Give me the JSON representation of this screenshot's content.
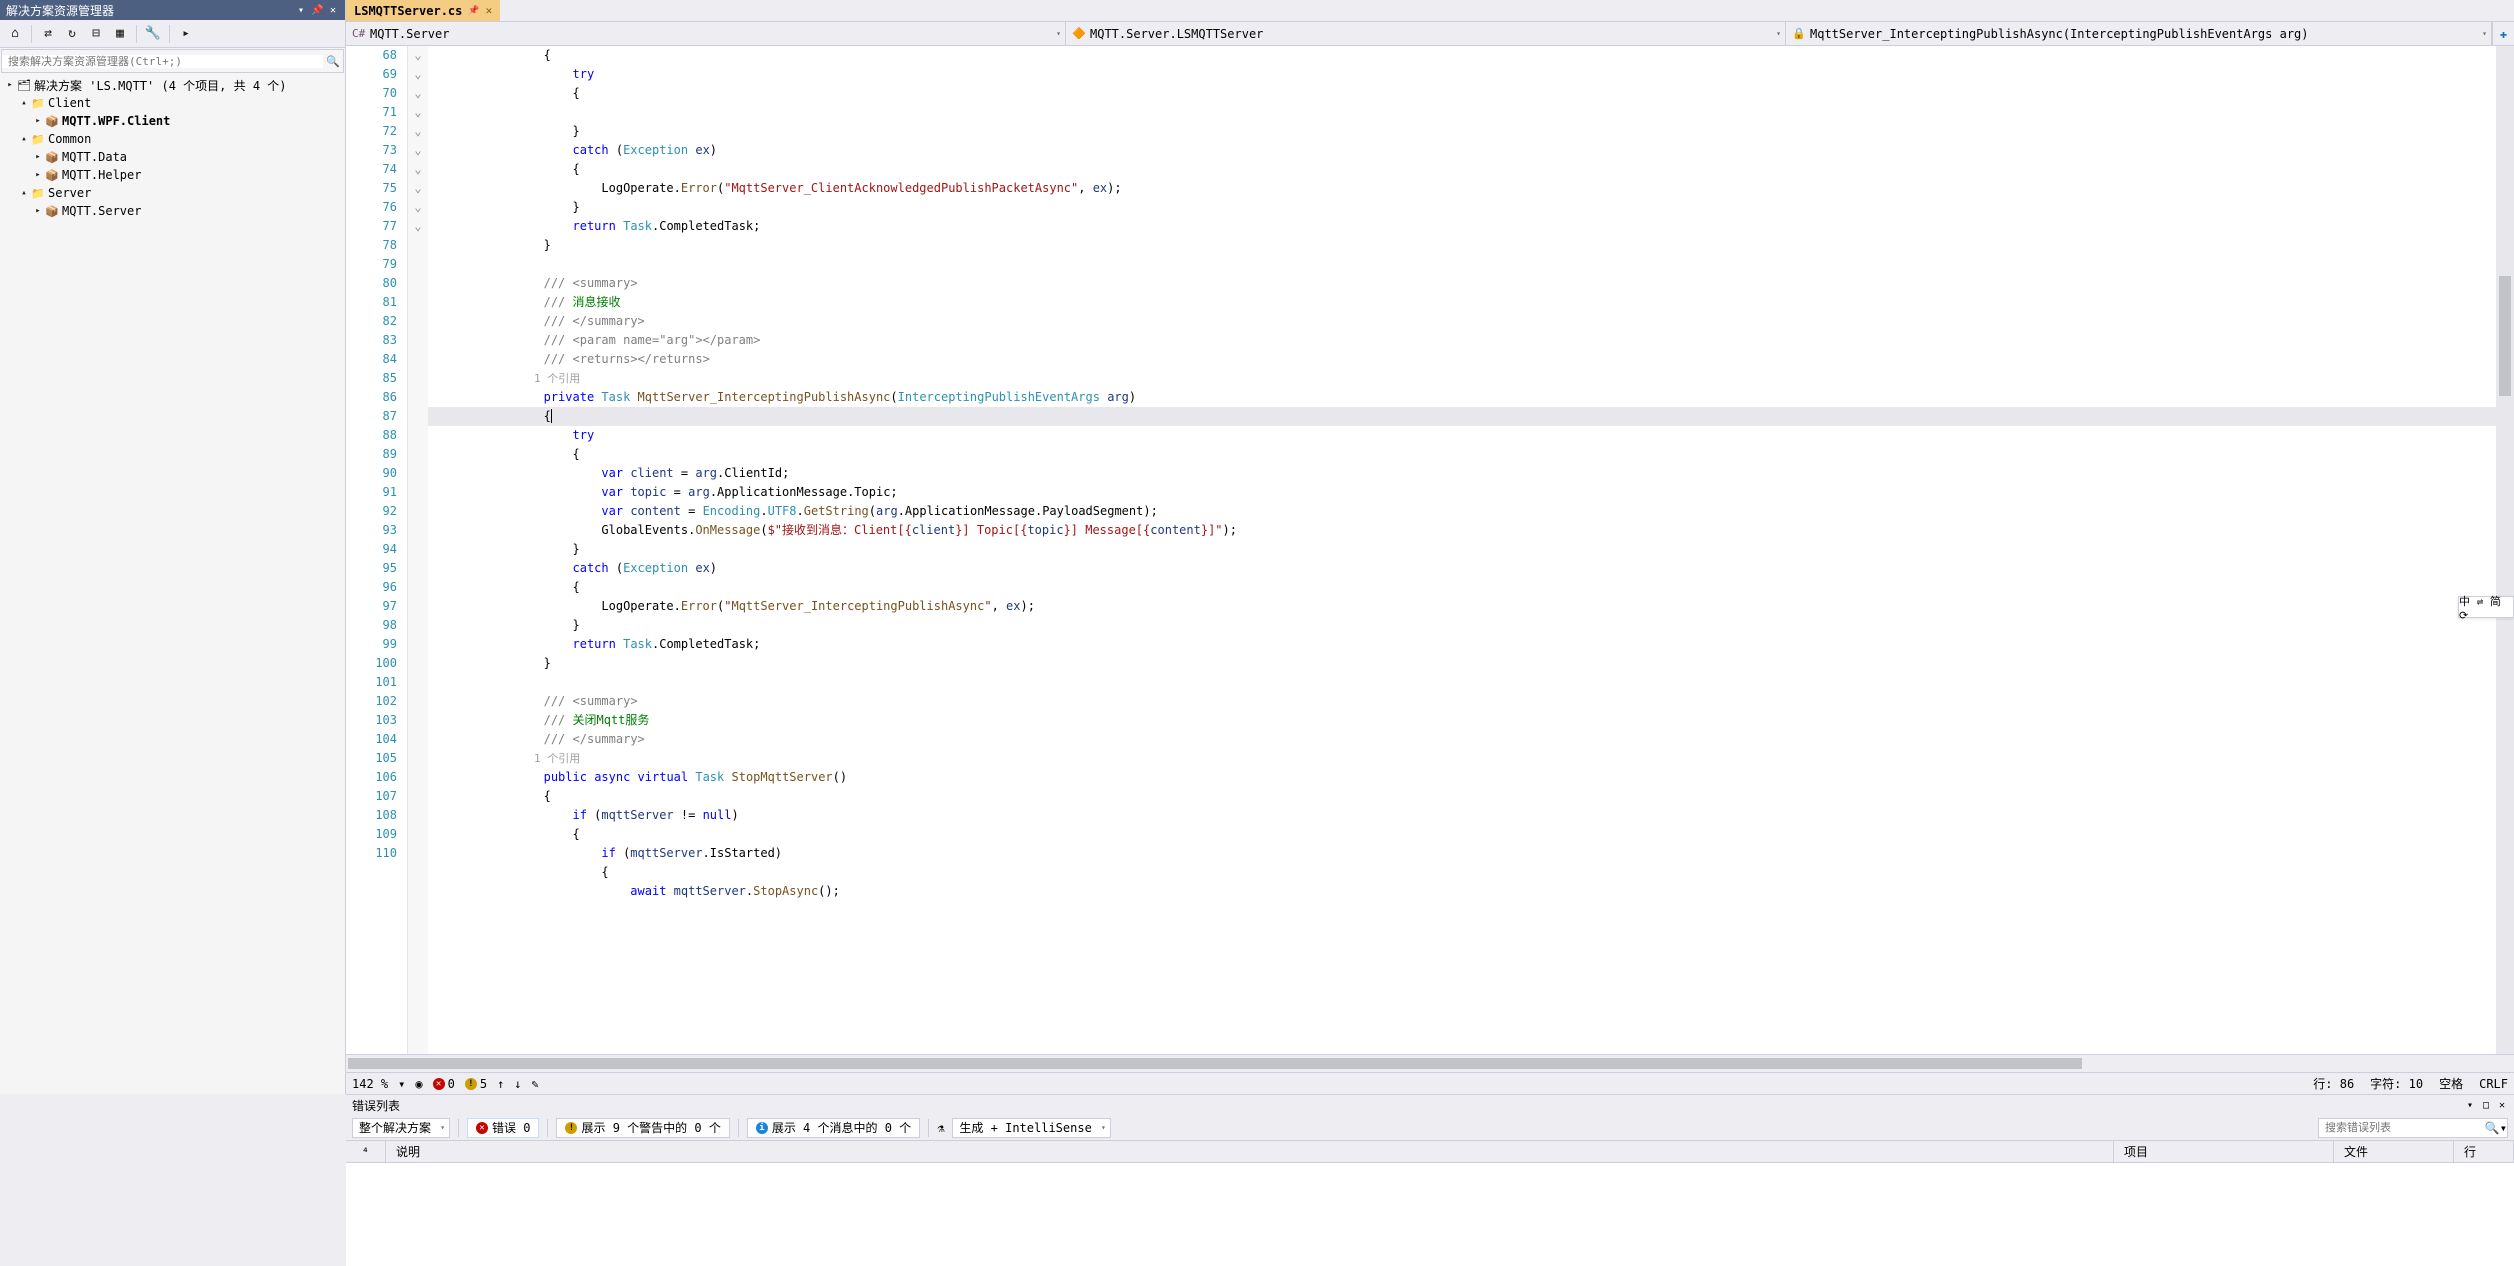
{
  "sidebar": {
    "title": "解决方案资源管理器",
    "searchPlaceholder": "搜索解决方案资源管理器(Ctrl+;)",
    "solution": "解决方案 'LS.MQTT' (4 个项目, 共 4 个)",
    "folders": {
      "client": "Client",
      "clientProj": "MQTT.WPF.Client",
      "common": "Common",
      "commonData": "MQTT.Data",
      "commonHelper": "MQTT.Helper",
      "server": "Server",
      "serverProj": "MQTT.Server"
    }
  },
  "tab": {
    "name": "LSMQTTServer.cs"
  },
  "nav": {
    "project": "MQTT.Server",
    "class": "MQTT.Server.LSMQTTServer",
    "method": "MqttServer_InterceptingPublishAsync(InterceptingPublishEventArgs arg)"
  },
  "errorlist": {
    "title": "错误列表",
    "scope": "整个解决方案",
    "errors": "错误 0",
    "warningsPill": "展示 9 个警告中的 0 个",
    "msgPill": "展示 4 个消息中的 0 个",
    "build": "生成 + IntelliSense",
    "searchPlaceholder": "搜索错误列表",
    "cols": {
      "code": "说明",
      "project": "项目",
      "file": "文件",
      "line": "行"
    }
  },
  "statusbar": {
    "zoom": "142 %",
    "err": "0",
    "warn": "5",
    "line": "行: 86",
    "col": "字符: 10",
    "spaces": "空格",
    "crlf": "CRLF"
  },
  "floatBadge": "中 ⇌ 简 ⟳",
  "chart_data": {
    "type": "code",
    "language": "csharp",
    "lines": [
      {
        "n": 68,
        "t": "                {"
      },
      {
        "n": 69,
        "t": "                    try",
        "fold": true
      },
      {
        "n": 70,
        "t": "                    {"
      },
      {
        "n": 71,
        "t": ""
      },
      {
        "n": 72,
        "t": "                    }"
      },
      {
        "n": 73,
        "t": "                    catch (Exception ex)",
        "fold": true
      },
      {
        "n": 74,
        "t": "                    {"
      },
      {
        "n": 75,
        "t": "                        LogOperate.Error(\"MqttServer_ClientAcknowledgedPublishPacketAsync\", ex);"
      },
      {
        "n": 76,
        "t": "                    }"
      },
      {
        "n": 77,
        "t": "                    return Task.CompletedTask;"
      },
      {
        "n": 78,
        "t": "                }"
      },
      {
        "n": 79,
        "t": ""
      },
      {
        "n": 80,
        "t": "                /// <summary>",
        "fold": true
      },
      {
        "n": 81,
        "t": "                /// 消息接收"
      },
      {
        "n": 82,
        "t": "                /// </summary>"
      },
      {
        "n": 83,
        "t": "                /// <param name=\"arg\"></param>"
      },
      {
        "n": 84,
        "t": "                /// <returns></returns>"
      },
      {
        "n": 0,
        "t": "                1 个引用",
        "ref": true
      },
      {
        "n": 85,
        "t": "                private Task MqttServer_InterceptingPublishAsync(InterceptingPublishEventArgs arg)",
        "fold": true
      },
      {
        "n": 86,
        "t": "                {",
        "active": true,
        "caret": true
      },
      {
        "n": 87,
        "t": "                    try",
        "fold": true
      },
      {
        "n": 88,
        "t": "                    {"
      },
      {
        "n": 89,
        "t": "                        var client = arg.ClientId;"
      },
      {
        "n": 90,
        "t": "                        var topic = arg.ApplicationMessage.Topic;"
      },
      {
        "n": 91,
        "t": "                        var content = Encoding.UTF8.GetString(arg.ApplicationMessage.PayloadSegment);"
      },
      {
        "n": 92,
        "t": "                        GlobalEvents.OnMessage($\"接收到消息：Client[{client}] Topic[{topic}] Message[{content}]\");"
      },
      {
        "n": 93,
        "t": "                    }"
      },
      {
        "n": 94,
        "t": "                    catch (Exception ex)",
        "fold": true
      },
      {
        "n": 95,
        "t": "                    {"
      },
      {
        "n": 96,
        "t": "                        LogOperate.Error(\"MqttServer_InterceptingPublishAsync\", ex);"
      },
      {
        "n": 97,
        "t": "                    }"
      },
      {
        "n": 98,
        "t": "                    return Task.CompletedTask;"
      },
      {
        "n": 99,
        "t": "                }"
      },
      {
        "n": 100,
        "t": ""
      },
      {
        "n": 101,
        "t": "                /// <summary>",
        "fold": true
      },
      {
        "n": 102,
        "t": "                /// 关闭Mqtt服务"
      },
      {
        "n": 103,
        "t": "                /// </summary>"
      },
      {
        "n": 0,
        "t": "                1 个引用",
        "ref": true
      },
      {
        "n": 104,
        "t": "                public async virtual Task StopMqttServer()",
        "fold": true
      },
      {
        "n": 105,
        "t": "                {"
      },
      {
        "n": 106,
        "t": "                    if (mqttServer != null)",
        "fold": true
      },
      {
        "n": 107,
        "t": "                    {"
      },
      {
        "n": 108,
        "t": "                        if (mqttServer.IsStarted)",
        "fold": true
      },
      {
        "n": 109,
        "t": "                        {"
      },
      {
        "n": 110,
        "t": "                            await mqttServer.StopAsync();"
      }
    ]
  }
}
